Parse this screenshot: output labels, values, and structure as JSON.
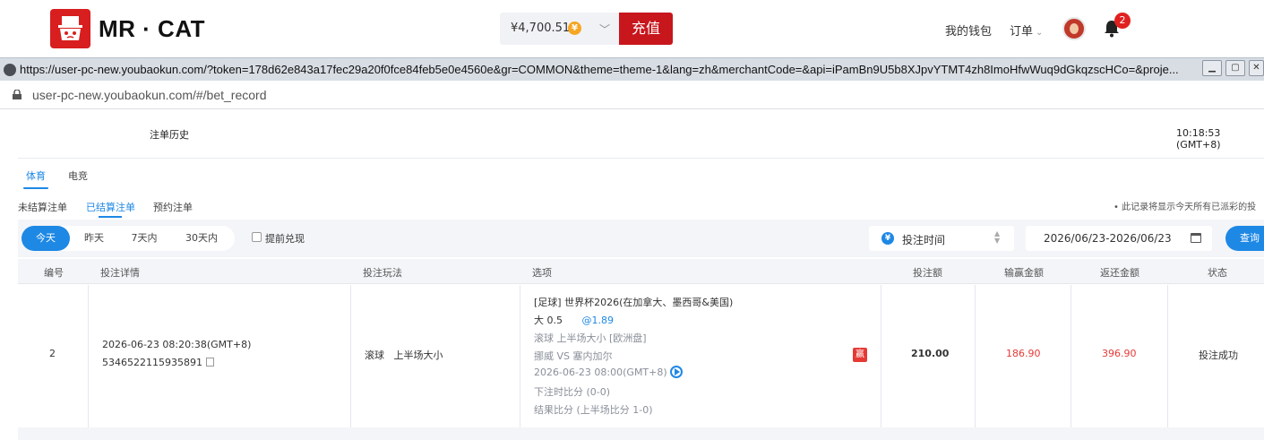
{
  "header": {
    "logo_text": "MR · CAT",
    "balance": "¥4,700.51",
    "coin_symbol": "¥",
    "recharge_label": "充值",
    "wallet_label": "我的钱包",
    "orders_label": "订单",
    "notification_count": "2"
  },
  "window": {
    "title_url": "https://user-pc-new.youbaokun.com/?token=178d62e843a17fec29a20f0fce84feb5e0e4560e&gr=COMMON&theme=theme-1&lang=zh&merchantCode=&api=iPamBn9U5b8XJpvYTMT4zh8ImoHfwWuq9dGkqzscHCo=&proje...",
    "address": "user-pc-new.youbaokun.com/#/bet_record"
  },
  "page": {
    "title": "注单历史",
    "clock": "10:18:53 (GMT+8)",
    "tabs": [
      {
        "label": "体育"
      },
      {
        "label": "电竞"
      }
    ],
    "subtabs": [
      {
        "label": "未结算注单"
      },
      {
        "label": "已结算注单"
      },
      {
        "label": "预约注单"
      }
    ],
    "note": "• 此记录将显示今天所有已派彩的投"
  },
  "filters": {
    "ranges": [
      {
        "label": "今天"
      },
      {
        "label": "昨天"
      },
      {
        "label": "7天内"
      },
      {
        "label": "30天内"
      }
    ],
    "early_cashout_label": "提前兑现",
    "sort_label": "投注时间",
    "sort_icon": "¥",
    "date_range": "2026/06/23-2026/06/23",
    "query_label": "查询"
  },
  "table": {
    "columns": [
      "编号",
      "投注详情",
      "投注玩法",
      "选项",
      "投注额",
      "输赢金额",
      "返还金额",
      "状态"
    ],
    "rows": [
      {
        "index": "2",
        "bet_time": "2026-06-23 08:20:38(GMT+8)",
        "order_no": "5346522115935891",
        "play_type": "滚球   上半场大小",
        "option_league": "[足球] 世界杯2026(在加拿大、墨西哥&美国)",
        "option_pick": "大 0.5",
        "option_odds": "@1.89",
        "option_market": "滚球 上半场大小 [欧洲盘]",
        "option_match": "挪威 VS 塞内加尔",
        "option_kickoff": "2026-06-23 08:00(GMT+8)",
        "option_score_at_bet": "下注时比分 (0-0)",
        "option_result": "结果比分 (上半场比分 1-0)",
        "win_tag": "赢",
        "stake": "210.00",
        "win_loss": "186.90",
        "returned": "396.90",
        "status": "投注成功"
      }
    ]
  }
}
